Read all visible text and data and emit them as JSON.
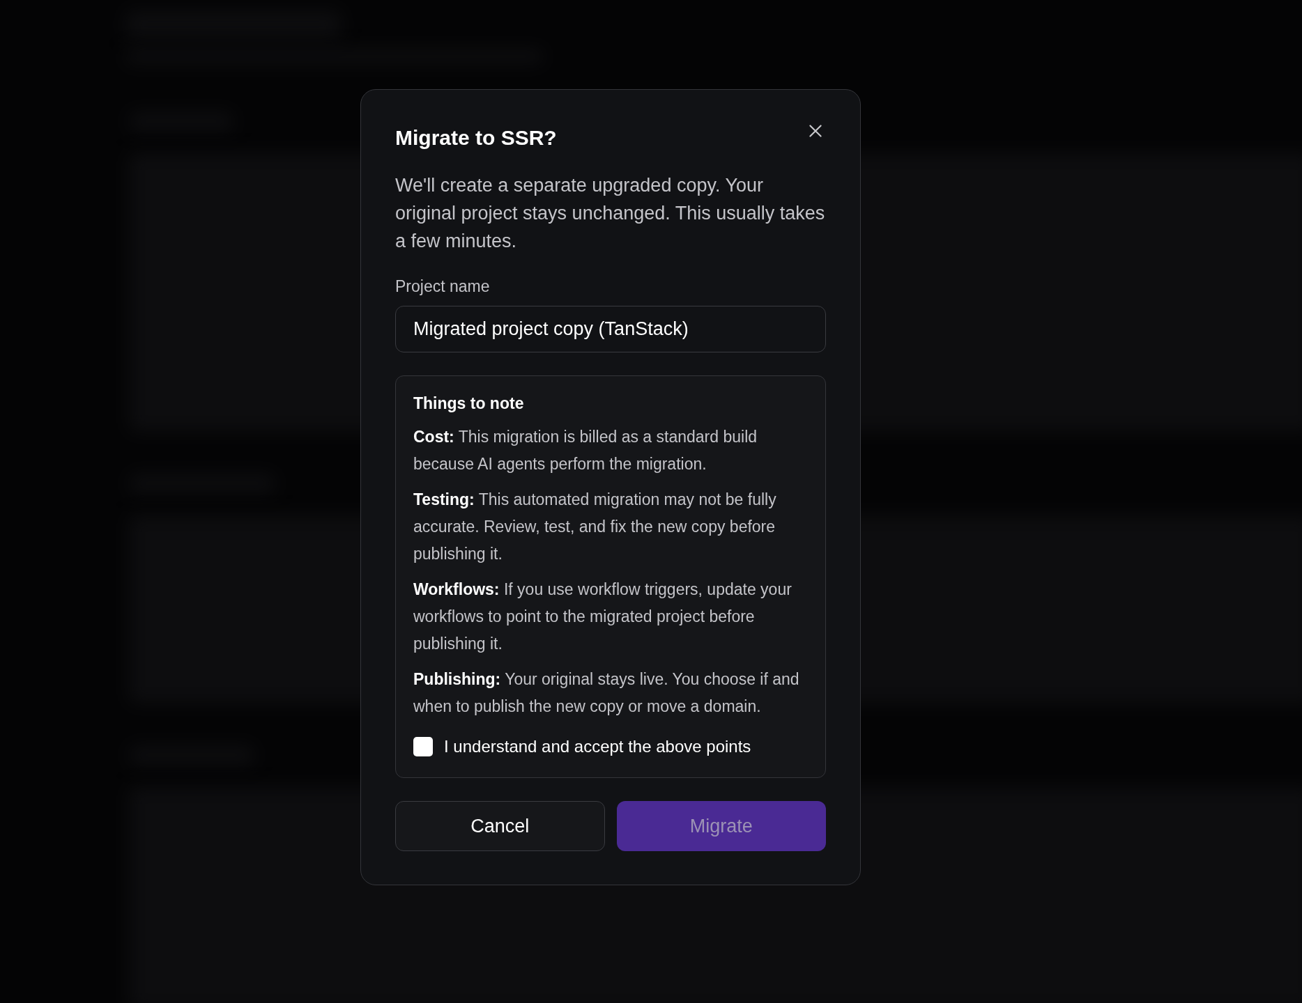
{
  "dialog": {
    "title": "Migrate to SSR?",
    "description": "We'll create a separate upgraded copy. Your original project stays unchanged. This usually takes a few minutes.",
    "field": {
      "label": "Project name",
      "value": "Migrated project copy (TanStack)"
    },
    "notes": {
      "title": "Things to note",
      "items": [
        "**Cost:** This migration is billed as a standard build because AI agents perform the migration.",
        "**Testing:** This automated migration may not be fully accurate. Review, test, and fix the new copy before publishing it.",
        "**Workflows:** If you use workflow triggers, update your workflows to point to the migrated project before publishing it.",
        "**Publishing:** Your original stays live. You choose if and when to publish the new copy or move a domain."
      ]
    },
    "checkbox": {
      "label": "I understand and accept the above points",
      "checked": false
    },
    "buttons": [
      {
        "label": "Cancel",
        "kind": "secondary",
        "disabled": false
      },
      {
        "label": "Migrate",
        "kind": "primary",
        "disabled": true
      }
    ]
  }
}
